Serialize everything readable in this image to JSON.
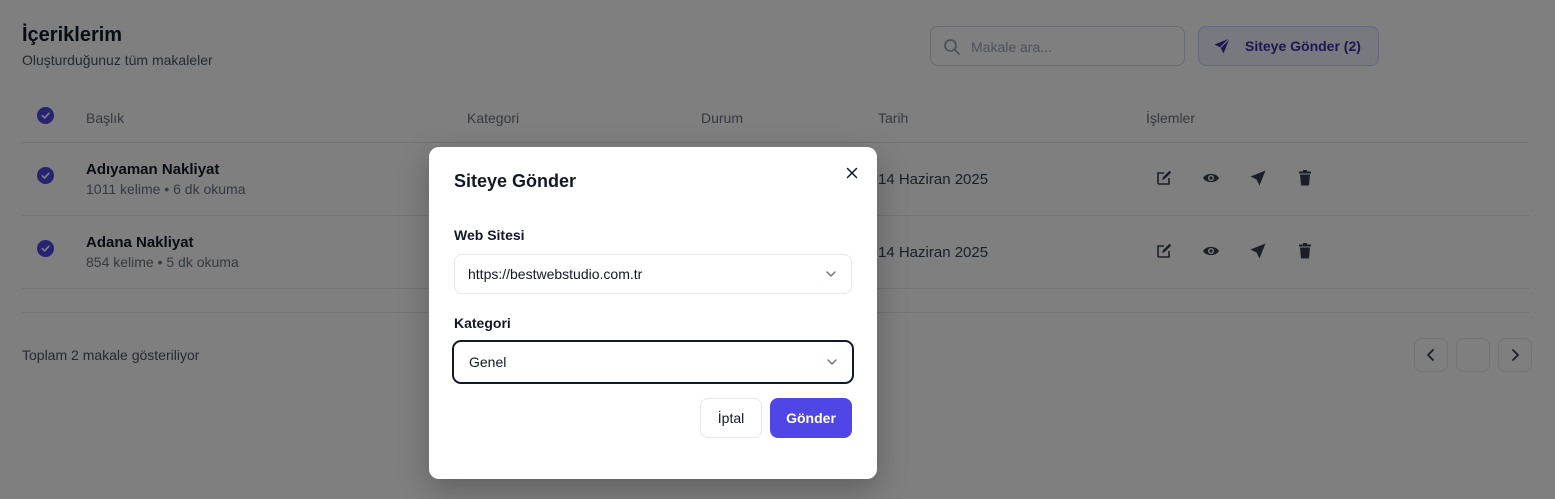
{
  "header": {
    "title": "İçeriklerim",
    "subtitle": "Oluşturduğunuz tüm makaleler",
    "search_placeholder": "Makale ara...",
    "send_button_label": "Siteye Gönder (2)"
  },
  "table": {
    "columns": [
      "Başlık",
      "Kategori",
      "Durum",
      "Tarih",
      "İşlemler"
    ],
    "rows": [
      {
        "title": "Adıyaman Nakliyat",
        "meta": "1011 kelime • 6 dk okuma",
        "date": "14 Haziran 2025",
        "selected": true
      },
      {
        "title": "Adana Nakliyat",
        "meta": "854 kelime • 5 dk okuma",
        "date": "14 Haziran 2025",
        "selected": true
      }
    ],
    "action_icons": [
      "edit-icon",
      "eye-icon",
      "send-icon",
      "trash-icon"
    ]
  },
  "footer": {
    "summary": "Toplam 2 makale gösteriliyor"
  },
  "modal": {
    "title": "Siteye Gönder",
    "website_label": "Web Sitesi",
    "website_value": "https://bestwebstudio.com.tr",
    "category_label": "Kategori",
    "category_value": "Genel",
    "cancel_label": "İptal",
    "submit_label": "Gönder"
  },
  "colors": {
    "accent": "#4f46e5",
    "overlay": "rgba(0,0,0,0.5)"
  }
}
